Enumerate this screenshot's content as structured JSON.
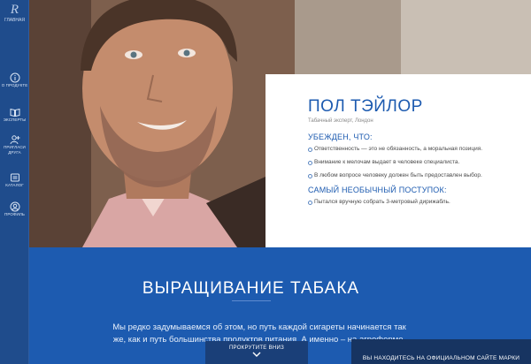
{
  "sidebar": {
    "logo_text": "ГЛАВНАЯ",
    "items": [
      {
        "label": "О ПРОДУКТЕ",
        "icon": "info-circle-icon"
      },
      {
        "label": "ЭКСПЕРТЫ",
        "icon": "book-icon"
      },
      {
        "label": "ПРИГЛАСИ ДРУГА",
        "icon": "invite-friend-icon"
      },
      {
        "label": "КАТАЛОГ",
        "icon": "catalog-icon"
      },
      {
        "label": "ПРОФИЛЬ",
        "icon": "profile-icon"
      }
    ]
  },
  "profile": {
    "name": "ПОЛ ТЭЙЛОР",
    "subtitle": "Табачный эксперт, Лондон",
    "beliefs_title": "УБЕЖДЕН, ЧТО:",
    "beliefs": [
      "Ответственность — это не обязанность, а моральная позиция.",
      "Внимание к мелочам выдает в человеке специалиста.",
      "В любом вопросе человеку должен быть предоставлен выбор."
    ],
    "unusual_title": "САМЫЙ НЕОБЫЧНЫЙ ПОСТУПОК:",
    "unusual": [
      "Пытался вручную собрать 3-метровый дирижабль."
    ]
  },
  "section": {
    "heading": "ВЫРАЩИВАНИЕ ТАБАКА",
    "intro": "Мы редко задумываемся об этом, но путь каждой сигареты начинается так же, как и путь большинства продуктов питания. А именно – на агроферме."
  },
  "footer": {
    "scroll_label": "ПРОКРУТИТЕ ВНИЗ",
    "official_label": "ВЫ НАХОДИТЕСЬ НА ОФИЦИАЛЬНОМ САЙТЕ МАРКИ ROTHMANS"
  },
  "colors": {
    "accent": "#1d5bb0",
    "sidebar": "#1f4c8c",
    "card": "#ffffff"
  }
}
